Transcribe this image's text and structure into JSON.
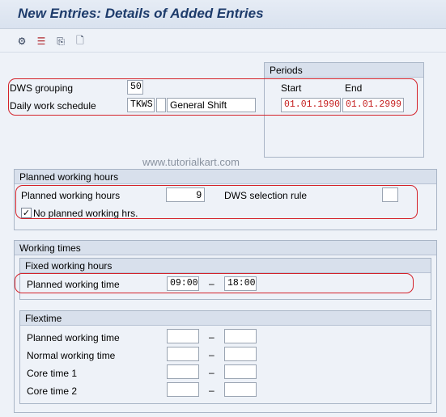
{
  "window": {
    "title": "New Entries: Details of Added Entries"
  },
  "toolbar": {
    "icons": [
      "display-change-icon",
      "delete-icon",
      "copy-icon",
      "new-entry-icon"
    ],
    "glyphs": [
      "⚙",
      "☰",
      "⎘",
      "🗋"
    ]
  },
  "header_fields": {
    "dws_grouping_label": "DWS grouping",
    "dws_grouping_value": "50",
    "daily_schedule_label": "Daily work schedule",
    "daily_schedule_code": "TKWS",
    "daily_schedule_variant": "",
    "daily_schedule_text": "General Shift",
    "nav_button": ">"
  },
  "periods": {
    "title": "Periods",
    "start_label": "Start",
    "end_label": "End",
    "start_value": "01.01.1990",
    "end_value": "01.01.2999"
  },
  "watermark": "www.tutorialkart.com",
  "planned_hours": {
    "title": "Planned working hours",
    "hours_label": "Planned working hours",
    "hours_value": "9",
    "dws_rule_label": "DWS selection rule",
    "dws_rule_value": "",
    "no_planned_label": "No planned working hrs.",
    "no_planned_checked": true,
    "check_glyph": "✓"
  },
  "working_times": {
    "title": "Working times",
    "fixed": {
      "title": "Fixed working hours",
      "label": "Planned working time",
      "from": "09:00",
      "dash": "–",
      "to": "18:00"
    },
    "flextime": {
      "title": "Flextime",
      "rows": [
        {
          "label": "Planned working time",
          "from": "",
          "to": ""
        },
        {
          "label": "Normal working time",
          "from": "",
          "to": ""
        },
        {
          "label": "Core time 1",
          "from": "",
          "to": ""
        },
        {
          "label": "Core time 2",
          "from": "",
          "to": ""
        }
      ]
    }
  },
  "colors": {
    "highlight": "#d4222a",
    "accent": "#1d3b6b"
  }
}
